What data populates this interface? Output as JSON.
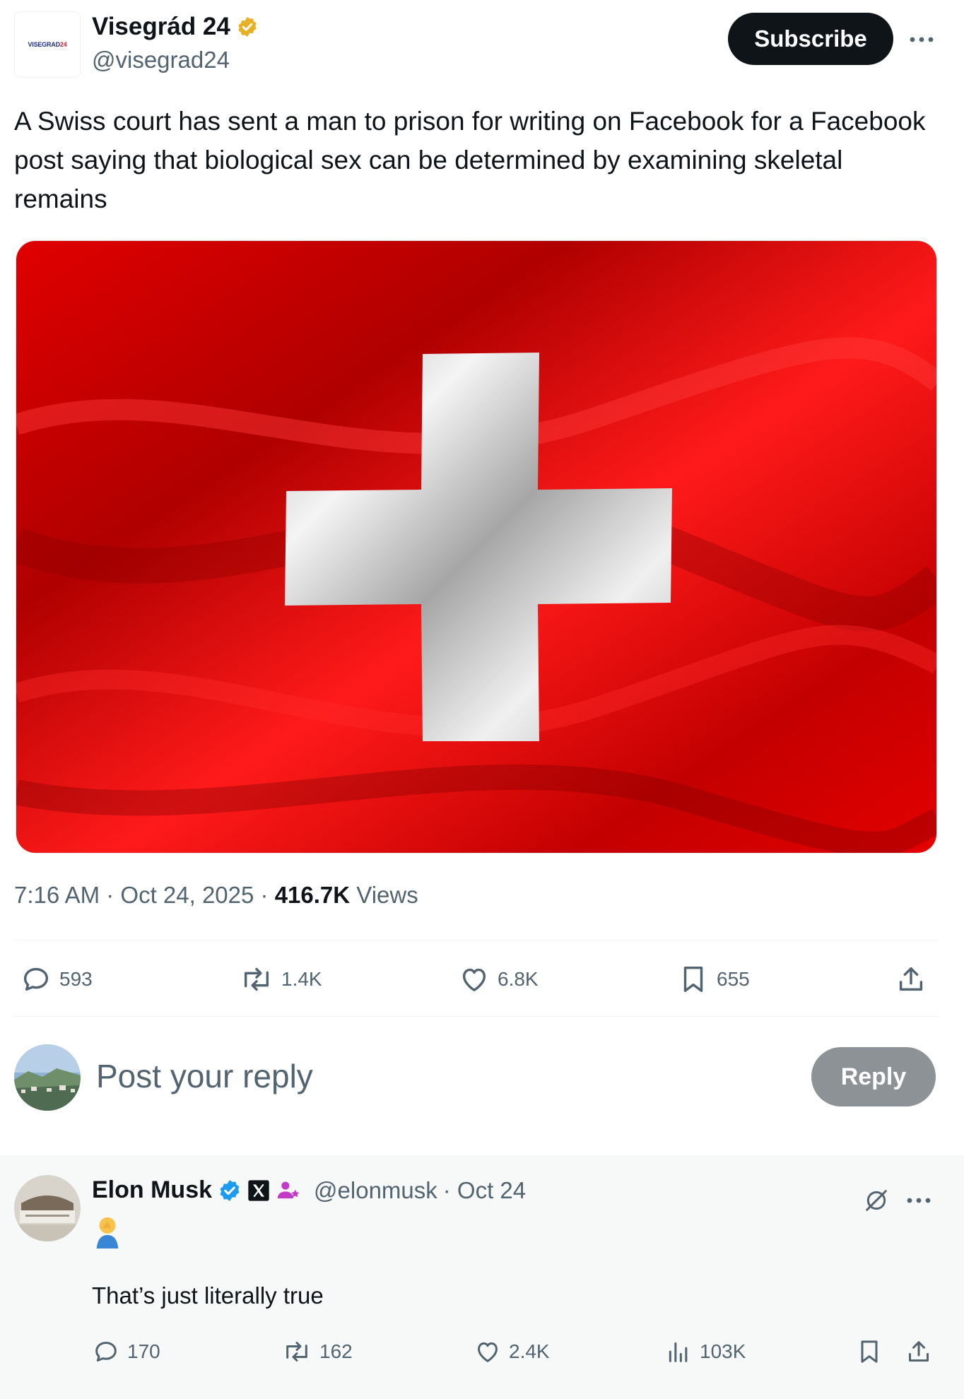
{
  "post": {
    "author_name": "Visegrád 24",
    "author_handle": "@visegrad24",
    "avatar_logo_text": "VISEGRAD",
    "avatar_logo_num": "24",
    "subscribe_label": "Subscribe",
    "text": "A Swiss court has sent a man to prison for writing on Facebook for a Facebook post saying that biological sex can be determined by examining skeletal remains",
    "time": "7:16 AM · Oct 24, 2025 · ",
    "views_count": "416.7K",
    "views_label": " Views",
    "stats": {
      "replies": "593",
      "reposts": "1.4K",
      "likes": "6.8K",
      "bookmarks": "655"
    }
  },
  "composer": {
    "placeholder": "Post your reply",
    "reply_button": "Reply"
  },
  "reply": {
    "author_name": "Elon Musk",
    "author_handle": "@elonmusk",
    "date": "· Oct 24",
    "text": "That’s just literally true",
    "stats": {
      "replies": "170",
      "reposts": "162",
      "likes": "2.4K",
      "views": "103K"
    }
  },
  "colors": {
    "text_primary": "#0f1419",
    "text_secondary": "#536471",
    "verified_gold": "#e8b125",
    "verified_blue": "#1d9bf0",
    "flag_red": "#d40000",
    "reply_card_bg": "#f7f9f9"
  },
  "icons": [
    "verified-gold-icon",
    "more-icon",
    "reply-icon",
    "repost-icon",
    "like-icon",
    "bookmark-icon",
    "share-icon",
    "verified-blue-icon",
    "x-logo-icon",
    "subscriber-badge-icon",
    "grok-icon",
    "views-icon",
    "facepalm-emoji"
  ]
}
